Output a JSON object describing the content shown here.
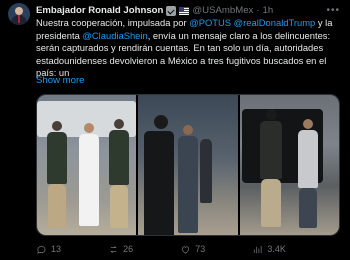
{
  "author": {
    "name": "Embajador Ronald Johnson",
    "handle": "@USAmbMex",
    "separator": "·",
    "time": "1h",
    "more_icon": "more-dots-icon"
  },
  "tweet": {
    "text_parts": [
      {
        "text": "Nuestra cooperación, impulsada por ",
        "link": false
      },
      {
        "text": "@POTUS",
        "link": true
      },
      {
        "text": " ",
        "link": false
      },
      {
        "text": "@realDonaldTrump",
        "link": true
      },
      {
        "text": " y la presidenta ",
        "link": false
      },
      {
        "text": "@ClaudiaShein",
        "link": true
      },
      {
        "text": ", envía un mensaje claro a los delincuentes: serán capturados y rendirán cuentas. En tan solo un día, autoridades estadounidenses devolvieron a México a tres fugitivos buscados en el país: un",
        "link": false
      }
    ],
    "show_more": "Show more"
  },
  "media": {
    "photos": [
      "photo-1",
      "photo-2",
      "photo-3"
    ]
  },
  "actions": {
    "replies": "13",
    "reposts": "26",
    "likes": "73",
    "views": "3.4K"
  },
  "colors": {
    "background": "#000000",
    "text": "#e7e9ea",
    "muted": "#71767b",
    "link": "#1d9bf0"
  }
}
